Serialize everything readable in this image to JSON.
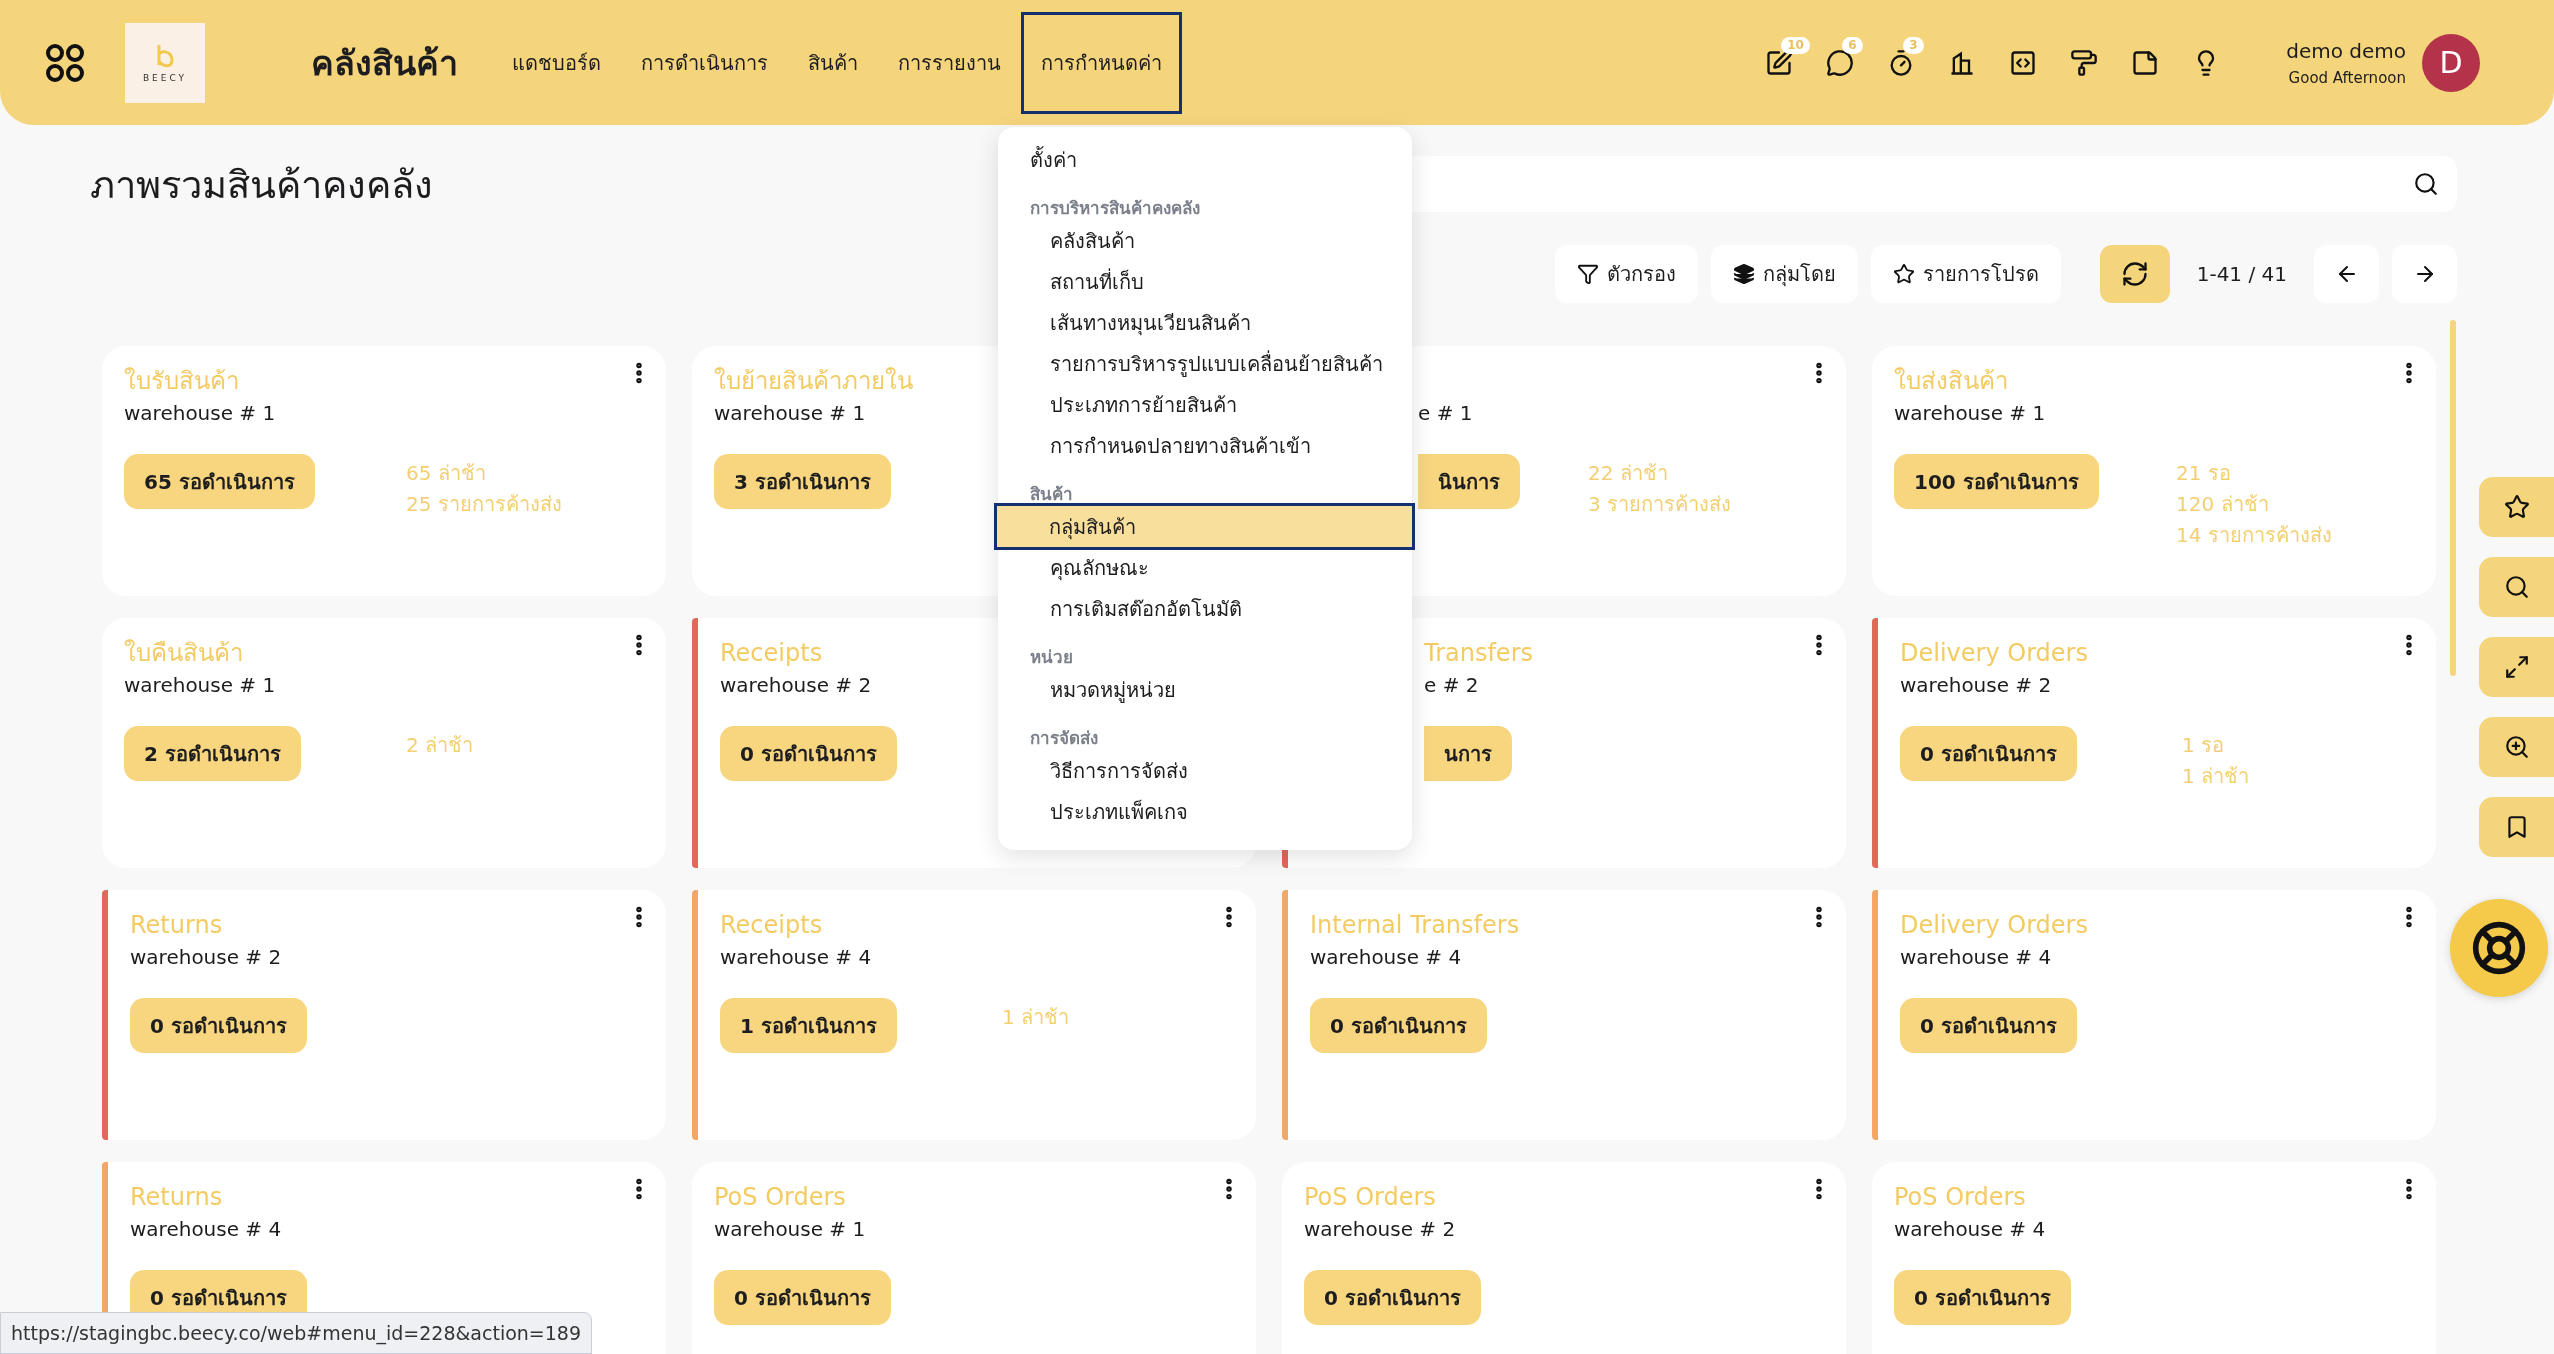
{
  "header": {
    "logo_text": "BEECY",
    "app_title": "คลังสินค้า",
    "nav": [
      {
        "label": "แดชบอร์ด",
        "selected": false
      },
      {
        "label": "การดำเนินการ",
        "selected": false
      },
      {
        "label": "สินค้า",
        "selected": false
      },
      {
        "label": "การรายงาน",
        "selected": false
      },
      {
        "label": "การกำหนดค่า",
        "selected": true
      }
    ],
    "icons": [
      {
        "kind": "edit",
        "badge": "10"
      },
      {
        "kind": "chat",
        "badge": "6"
      },
      {
        "kind": "timer",
        "badge": "3"
      },
      {
        "kind": "building"
      },
      {
        "kind": "code"
      },
      {
        "kind": "roller"
      },
      {
        "kind": "note"
      },
      {
        "kind": "bulb"
      }
    ],
    "user": {
      "name": "demo demo",
      "greeting": "Good Afternoon",
      "avatar": "D"
    }
  },
  "page_title": "ภาพรวมสินค้าคงคลัง",
  "toolbar": {
    "buttons": [
      {
        "kind": "filter",
        "label": "ตัวกรอง"
      },
      {
        "kind": "group",
        "label": "กลุ่มโดย"
      },
      {
        "kind": "favorite",
        "label": "รายการโปรด"
      }
    ],
    "pager": "1-41 / 41"
  },
  "cards": [
    {
      "title": "ใบรับสินค้า",
      "warehouse": "warehouse # 1",
      "pending": "65 รอดำเนินการ",
      "stats": [
        "65 ล่าช้า",
        "25 รายการค้างส่ง"
      ]
    },
    {
      "title": "ใบย้ายสินค้าภายใน",
      "warehouse": "warehouse # 1",
      "pending": "3 รอดำเนินการ"
    },
    {
      "covered": true,
      "warehouse": "e # 1",
      "pending": "นินการ",
      "stats": [
        "22 ล่าช้า",
        "3 รายการค้างส่ง"
      ]
    },
    {
      "title": "ใบส่งสินค้า",
      "warehouse": "warehouse # 1",
      "pending": "100 รอดำเนินการ",
      "stats": [
        "21 รอ",
        "120 ล่าช้า",
        "14 รายการค้างส่ง"
      ]
    },
    {
      "title": "ใบคืนสินค้า",
      "warehouse": "warehouse # 1",
      "pending": "2 รอดำเนินการ",
      "stats": [
        "2 ล่าช้า"
      ]
    },
    {
      "title": "Receipts",
      "warehouse": "warehouse # 2",
      "pending": "0 รอดำเนินการ",
      "color": "#e2685a"
    },
    {
      "covered": true,
      "title": "Transfers",
      "warehouse": "e # 2",
      "pending": "นการ",
      "color": "#e2685a"
    },
    {
      "title": "Delivery Orders",
      "warehouse": "warehouse # 2",
      "pending": "0 รอดำเนินการ",
      "stats": [
        "1 รอ",
        "1 ล่าช้า"
      ],
      "color": "#e2685a"
    },
    {
      "title": "Returns",
      "warehouse": "warehouse # 2",
      "pending": "0 รอดำเนินการ",
      "color": "#e2685a"
    },
    {
      "title": "Receipts",
      "warehouse": "warehouse # 4",
      "pending": "1 รอดำเนินการ",
      "stats": [
        "1 ล่าช้า"
      ],
      "color": "#f0a868"
    },
    {
      "title": "Internal Transfers",
      "warehouse": "warehouse # 4",
      "pending": "0 รอดำเนินการ",
      "color": "#f0a868"
    },
    {
      "title": "Delivery Orders",
      "warehouse": "warehouse # 4",
      "pending": "0 รอดำเนินการ",
      "color": "#f0a868"
    },
    {
      "title": "Returns",
      "warehouse": "warehouse # 4",
      "pending": "0 รอดำเนินการ",
      "color": "#f0a868"
    },
    {
      "title": "PoS Orders",
      "warehouse": "warehouse # 1",
      "pending": "0 รอดำเนินการ"
    },
    {
      "title": "PoS Orders",
      "warehouse": "warehouse # 2",
      "pending": "0 รอดำเนินการ"
    },
    {
      "title": "PoS Orders",
      "warehouse": "warehouse # 4",
      "pending": "0 รอดำเนินการ"
    }
  ],
  "settings_menu": [
    {
      "kind": "item",
      "label": "ตั้งค่า",
      "selected": false
    },
    {
      "kind": "header",
      "label": "การบริหารสินค้าคงคลัง"
    },
    {
      "kind": "subitem",
      "label": "คลังสินค้า",
      "selected": false
    },
    {
      "kind": "subitem",
      "label": "สถานที่เก็บ",
      "selected": false
    },
    {
      "kind": "subitem",
      "label": "เส้นทางหมุนเวียนสินค้า",
      "selected": false
    },
    {
      "kind": "subitem",
      "label": "รายการบริหารรูปแบบเคลื่อนย้ายสินค้า",
      "selected": false
    },
    {
      "kind": "subitem",
      "label": "ประเภทการย้ายสินค้า",
      "selected": false
    },
    {
      "kind": "subitem",
      "label": "การกำหนดปลายทางสินค้าเข้า",
      "selected": false
    },
    {
      "kind": "header",
      "label": "สินค้า"
    },
    {
      "kind": "subitem",
      "label": "กลุ่มสินค้า",
      "selected": true
    },
    {
      "kind": "subitem",
      "label": "คุณลักษณะ",
      "selected": false
    },
    {
      "kind": "subitem",
      "label": "การเติมสต๊อกอัตโนมัติ",
      "selected": false
    },
    {
      "kind": "header",
      "label": "หน่วย"
    },
    {
      "kind": "subitem",
      "label": "หมวดหมู่หน่วย",
      "selected": false
    },
    {
      "kind": "header",
      "label": "การจัดส่ง"
    },
    {
      "kind": "subitem",
      "label": "วิธีการการจัดส่ง",
      "selected": false
    },
    {
      "kind": "subitem",
      "label": "ประเภทแพ็คเกจ",
      "selected": false
    }
  ],
  "side_tools": [
    {
      "kind": "star"
    },
    {
      "kind": "search"
    },
    {
      "kind": "expand"
    },
    {
      "kind": "zoom"
    },
    {
      "kind": "bookmark"
    }
  ],
  "status_url": "https://stagingbc.beecy.co/web#menu_id=228&action=189"
}
